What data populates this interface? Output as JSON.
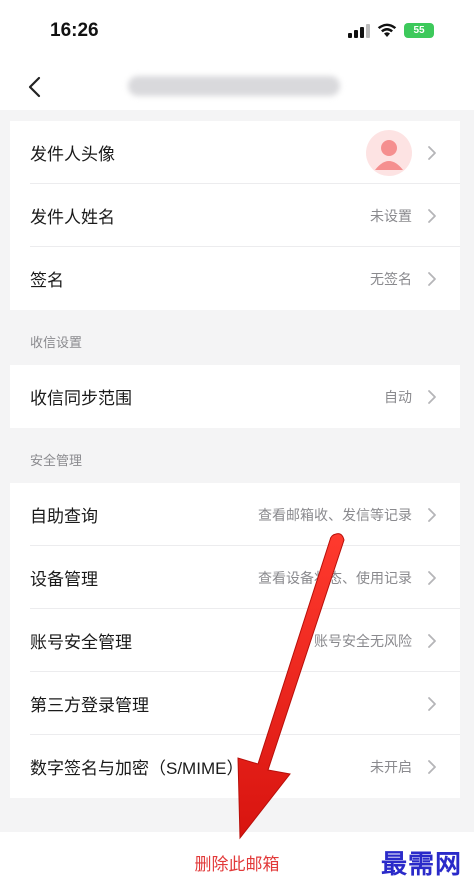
{
  "status_bar": {
    "time": "16:26",
    "battery": "55"
  },
  "nav": {
    "title": "••••••••••••••••"
  },
  "sender": {
    "avatar_label": "发件人头像",
    "name_label": "发件人姓名",
    "name_value": "未设置",
    "signature_label": "签名",
    "signature_value": "无签名"
  },
  "receive_section": {
    "header": "收信设置",
    "sync_label": "收信同步范围",
    "sync_value": "自动"
  },
  "security_section": {
    "header": "安全管理",
    "self_query_label": "自助查询",
    "self_query_value": "查看邮箱收、发信等记录",
    "device_label": "设备管理",
    "device_value": "查看设备状态、使用记录",
    "account_security_label": "账号安全管理",
    "account_security_value": "账号安全无风险",
    "third_party_label": "第三方登录管理",
    "smime_label": "数字签名与加密（S/MIME）",
    "smime_value": "未开启"
  },
  "delete_button": "删除此邮箱",
  "watermark": "最需网",
  "colors": {
    "accent_red": "#e23a3a",
    "annotation_arrow": "#e8231f",
    "watermark": "#2a2ac9"
  }
}
